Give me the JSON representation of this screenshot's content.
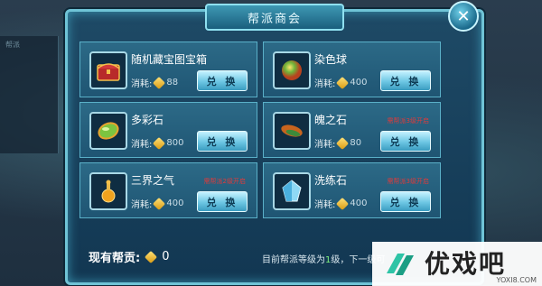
{
  "background": {
    "left_panel_lines": [
      "帮派",
      "",
      "",
      ""
    ]
  },
  "dialog": {
    "title": "帮派商会",
    "close_icon": "close-x"
  },
  "items": [
    {
      "name": "随机藏宝图宝箱",
      "cost_label": "消耗:",
      "cost": "88",
      "button": "兑 换",
      "requirement": "",
      "icon": "treasure-chest-icon"
    },
    {
      "name": "染色球",
      "cost_label": "消耗:",
      "cost": "400",
      "button": "兑 换",
      "requirement": "",
      "icon": "dye-ball-icon"
    },
    {
      "name": "多彩石",
      "cost_label": "消耗:",
      "cost": "800",
      "button": "兑 换",
      "requirement": "",
      "icon": "colorful-stone-icon"
    },
    {
      "name": "魄之石",
      "cost_label": "消耗:",
      "cost": "80",
      "button": "兑 换",
      "requirement": "需帮派3级开启",
      "icon": "soul-stone-icon"
    },
    {
      "name": "三界之气",
      "cost_label": "消耗:",
      "cost": "400",
      "button": "兑 换",
      "requirement": "需帮派2级开启",
      "icon": "essence-bottle-icon"
    },
    {
      "name": "洗练石",
      "cost_label": "消耗:",
      "cost": "400",
      "button": "兑 换",
      "requirement": "需帮派3级开启",
      "icon": "refining-stone-icon"
    }
  ],
  "footer": {
    "contribution_label": "现有帮贡:",
    "contribution_value": "0",
    "level_prefix": "目前帮派等级为",
    "level_value": "1",
    "level_suffix": "级，下一级可"
  },
  "watermark": {
    "text": "优戏吧",
    "sub": "YOXI8.COM"
  },
  "colors": {
    "accent": "#6fc3d6",
    "requirement": "#e23a3a",
    "level": "#7ef07e"
  }
}
